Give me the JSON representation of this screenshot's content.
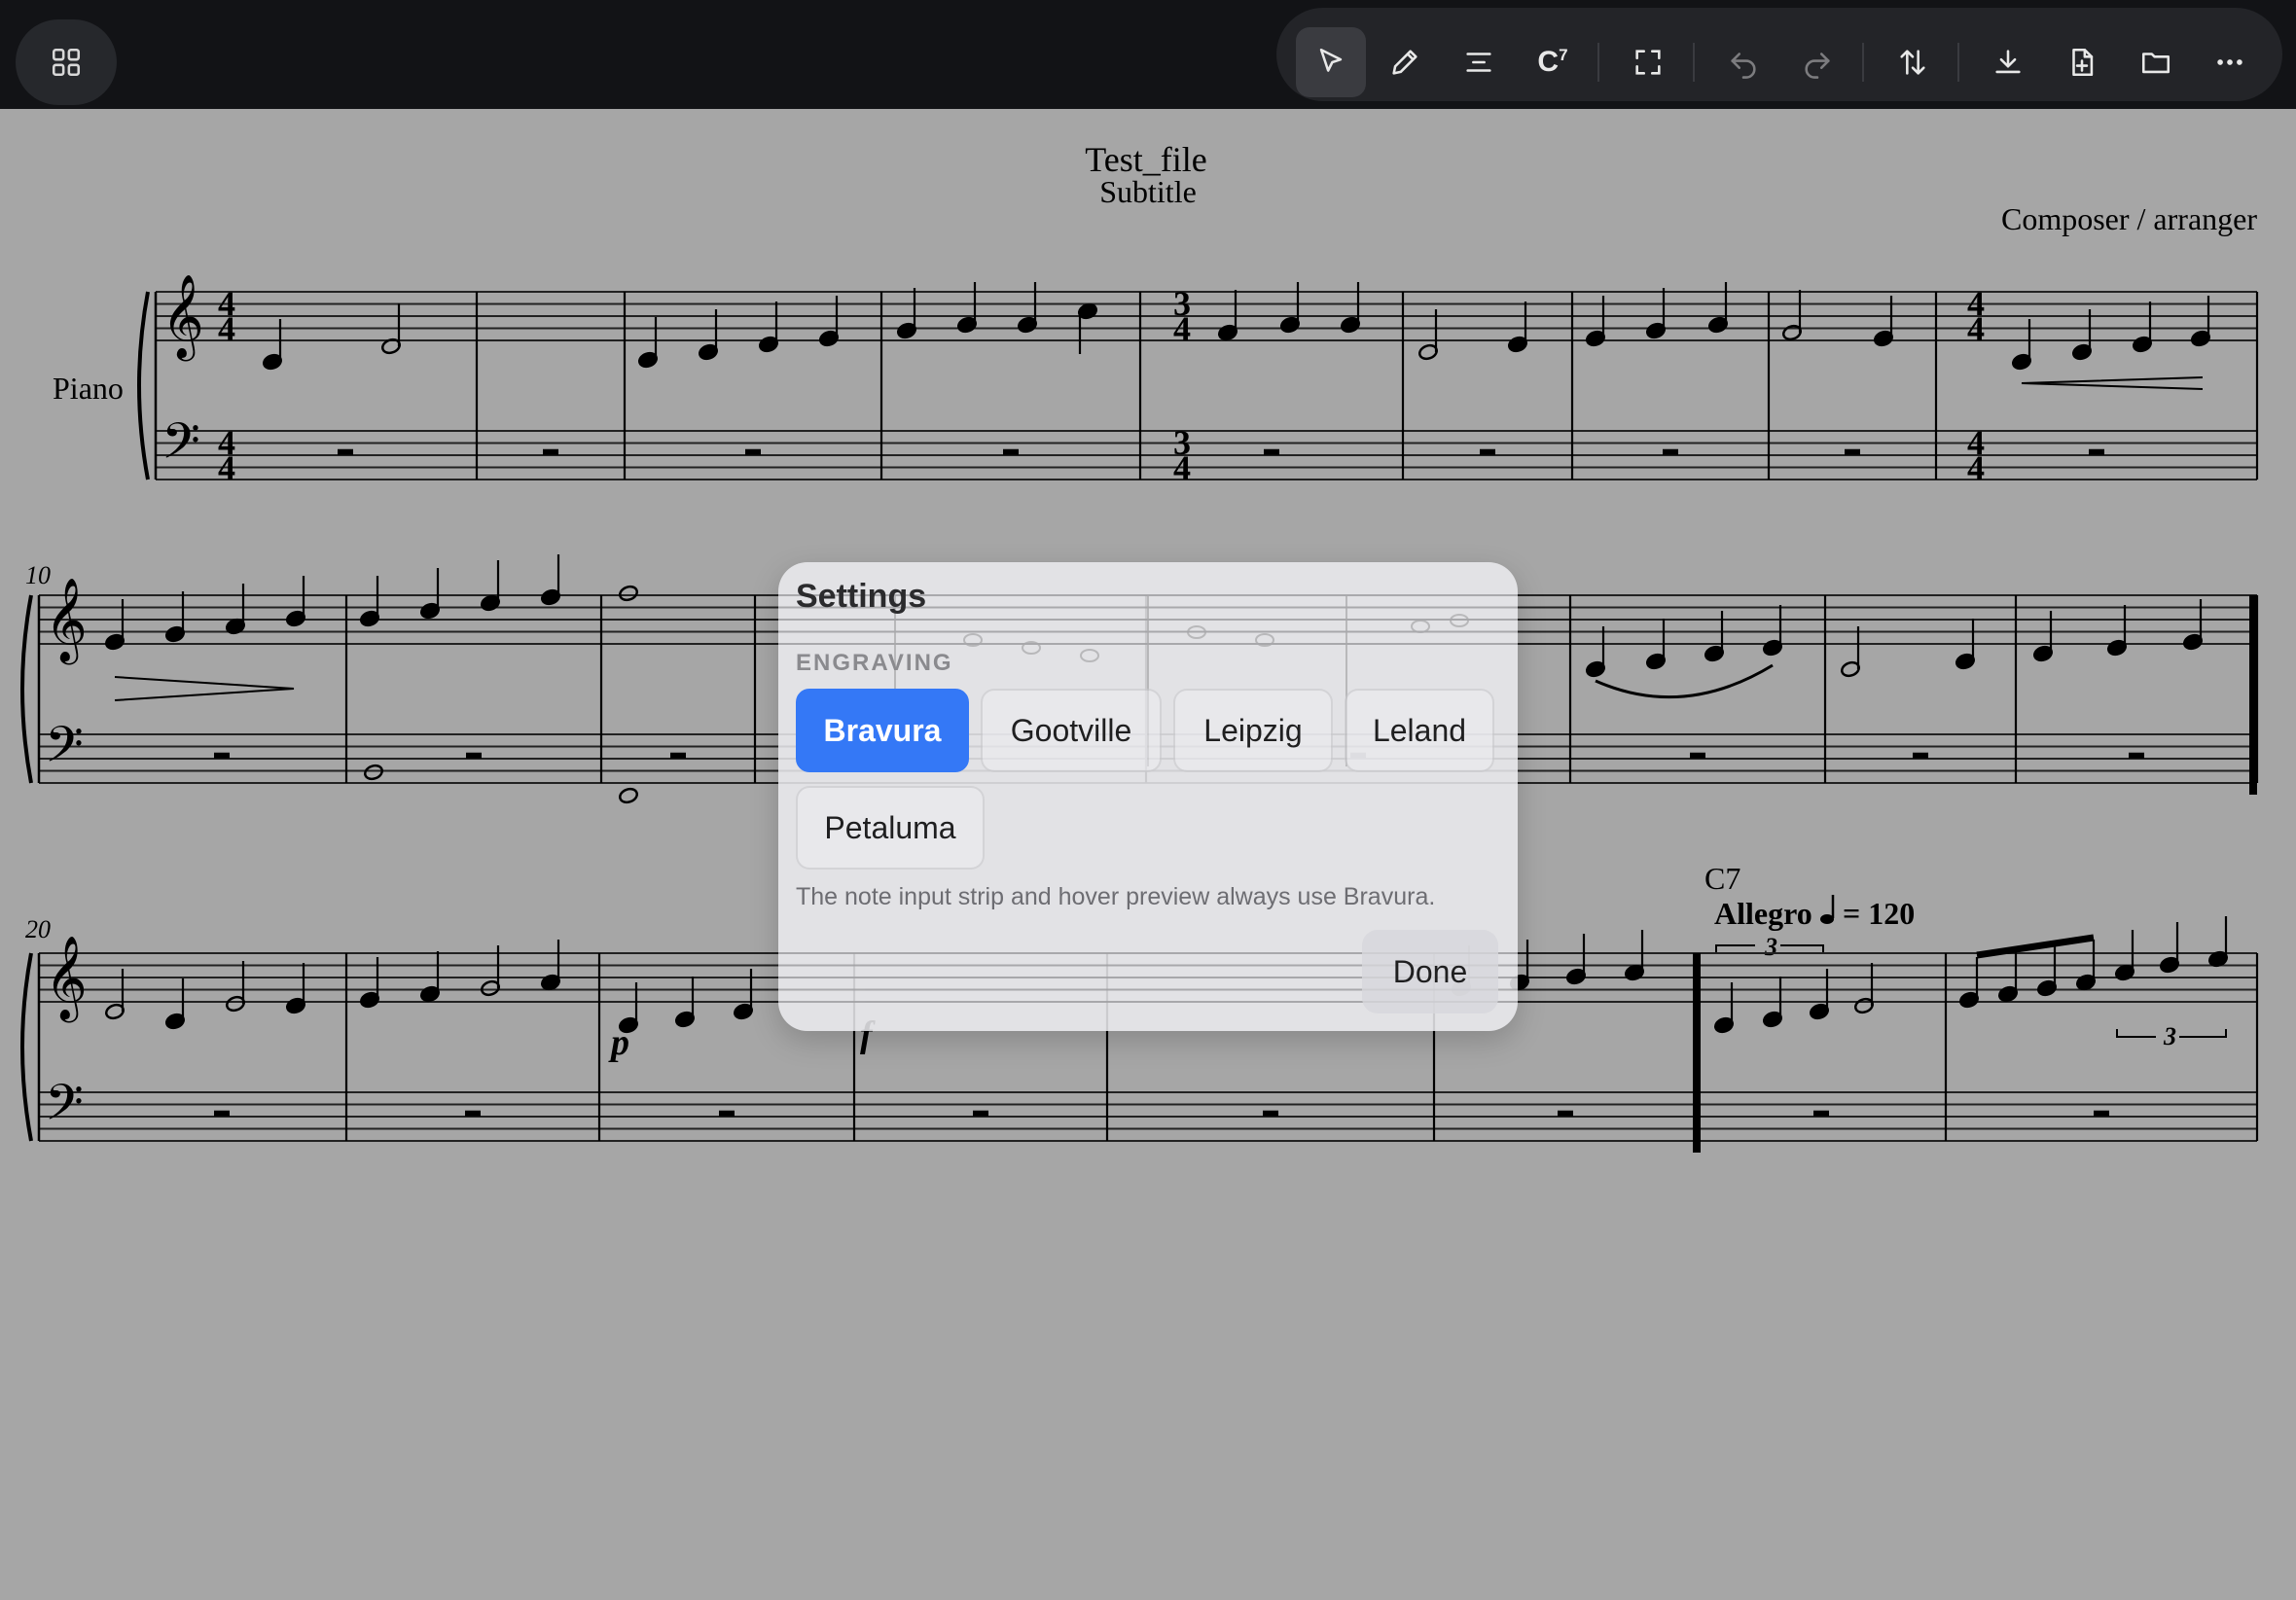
{
  "toolbar": {
    "chord_glyph": "C",
    "chord_sup": "7",
    "items": [
      "select-icon",
      "pencil-icon",
      "align-icon",
      "chord-symbol-icon",
      "fullscreen-icon",
      "undo-icon",
      "redo-icon",
      "transpose-icon",
      "download-icon",
      "new-file-icon",
      "folder-icon",
      "more-icon"
    ]
  },
  "score": {
    "title": "Test_file",
    "subtitle": "Subtitle",
    "composer": "Composer / arranger",
    "instrument": "Piano",
    "measure_numbers": [
      "10",
      "20"
    ],
    "chord_symbol": "C7",
    "tempo_text": "Allegro",
    "tempo_value": "= 120",
    "tuplet_number": "3",
    "dynamics": [
      "p",
      "f"
    ]
  },
  "dialog": {
    "title": "Settings",
    "section_label": "ENGRAVING",
    "fonts": [
      "Bravura",
      "Gootville",
      "Leipzig",
      "Leland",
      "Petaluma"
    ],
    "selected_font": "Bravura",
    "note": "The note input strip and hover preview always use Bravura.",
    "done_label": "Done"
  },
  "colors": {
    "topbar": "#121316",
    "page_background": "#a6a6a6",
    "accent": "#3478f6"
  }
}
